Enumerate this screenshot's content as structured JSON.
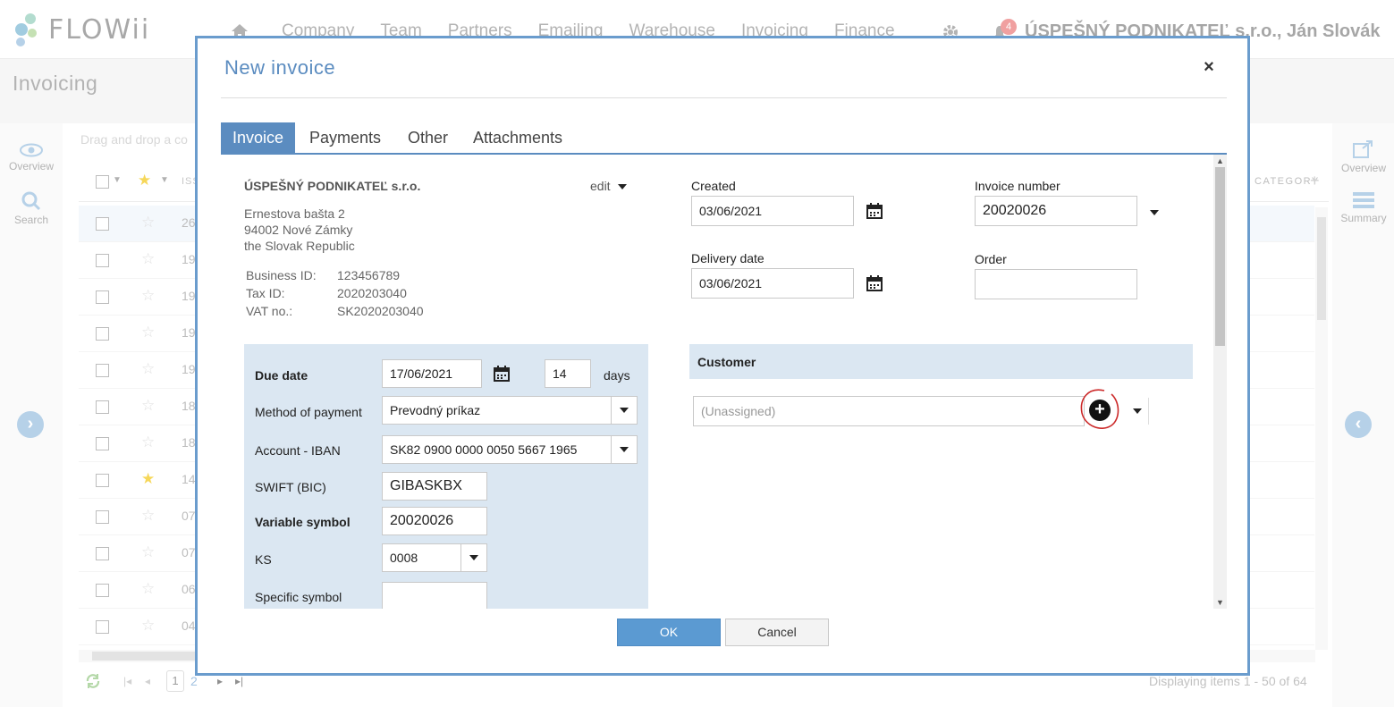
{
  "app": {
    "logo_text": "FLOWii",
    "nav": [
      "Company",
      "Team",
      "Partners",
      "Emailing",
      "Warehouse",
      "Invoicing",
      "Finance"
    ],
    "notifications_count": "4",
    "company_user": "ÚSPEŠNÝ PODNIKATEĽ s.r.o., Ján Slovák",
    "page_title": "Invoicing",
    "left_rail": {
      "overview": "Overview",
      "search": "Search"
    },
    "right_rail": {
      "overview": "Overview",
      "summary": "Summary"
    },
    "drag_drop_hint": "Drag and drop a co",
    "grid_header_issue": "ISS",
    "grid_category_header": "CATEGORY",
    "rows": [
      {
        "num": "26",
        "starred": false
      },
      {
        "num": "19",
        "starred": false
      },
      {
        "num": "19",
        "starred": false
      },
      {
        "num": "19",
        "starred": false
      },
      {
        "num": "19",
        "starred": false
      },
      {
        "num": "18",
        "starred": false
      },
      {
        "num": "18",
        "starred": false
      },
      {
        "num": "14",
        "starred": true
      },
      {
        "num": "07",
        "starred": false
      },
      {
        "num": "07",
        "starred": false
      },
      {
        "num": "06",
        "starred": false
      },
      {
        "num": "04",
        "starred": false
      }
    ],
    "pager": {
      "current": "1",
      "next": "2",
      "summary": "Displaying items 1 - 50 of 64"
    }
  },
  "modal": {
    "title": "New invoice",
    "close": "×",
    "tabs": [
      "Invoice",
      "Payments",
      "Other",
      "Attachments"
    ],
    "active_tab": "Invoice",
    "seller": {
      "name": "ÚSPEŠNÝ PODNIKATEĽ s.r.o.",
      "edit_label": "edit",
      "address": [
        "Ernestova bašta 2",
        "94002 Nové Zámky",
        "the Slovak Republic"
      ],
      "ids": [
        {
          "label": "Business ID:",
          "value": "123456789"
        },
        {
          "label": "Tax ID:",
          "value": "2020203040"
        },
        {
          "label": "VAT no.:",
          "value": "SK2020203040"
        }
      ]
    },
    "payment": {
      "due_date_label": "Due date",
      "due_date": "17/06/2021",
      "due_days": "14",
      "days_label": "days",
      "method_label": "Method of payment",
      "method": "Prevodný príkaz",
      "iban_label": "Account - IBAN",
      "iban": "SK82 0900 0000 0050 5667 1965",
      "swift_label": "SWIFT (BIC)",
      "swift": "GIBASKBX",
      "vs_label": "Variable symbol",
      "vs": "20020026",
      "ks_label": "KS",
      "ks": "0008",
      "ss_label": "Specific symbol",
      "ss": ""
    },
    "dates": {
      "created_label": "Created",
      "created": "03/06/2021",
      "delivery_label": "Delivery date",
      "delivery": "03/06/2021",
      "invoice_number_label": "Invoice number",
      "invoice_number": "20020026",
      "order_label": "Order",
      "order": ""
    },
    "customer": {
      "header": "Customer",
      "placeholder": "(Unassigned)"
    },
    "ok_label": "OK",
    "cancel_label": "Cancel"
  },
  "colors": {
    "accent": "#5b8cc0",
    "panel_bg": "#dbe7f2",
    "ok_button": "#5b9ad2",
    "highlight_ring": "#cc2a2a"
  }
}
